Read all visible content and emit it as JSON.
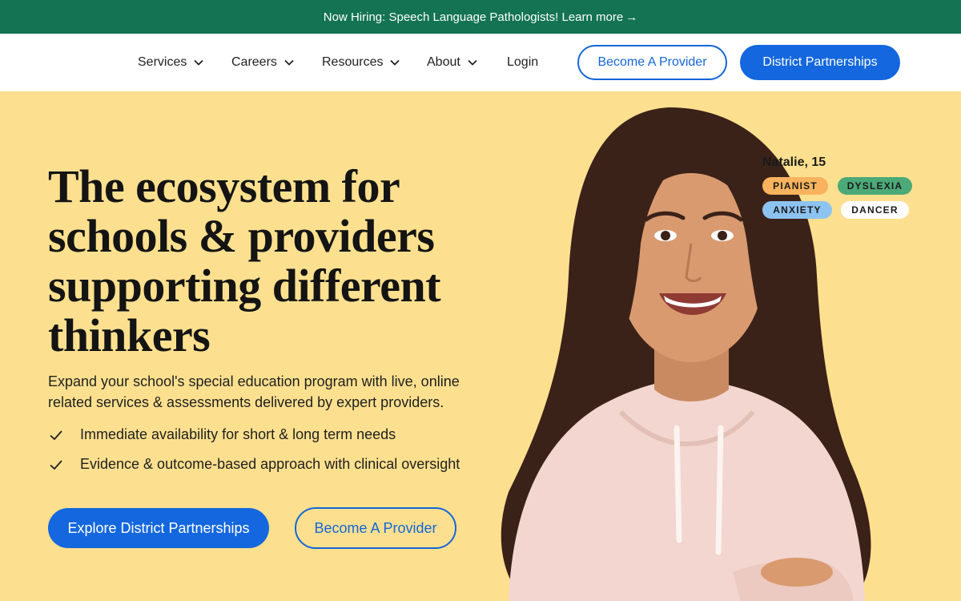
{
  "announcement": {
    "text": "Now Hiring: Speech Language Pathologists! Learn more",
    "arrow": "→"
  },
  "nav": {
    "items": [
      {
        "label": "Services"
      },
      {
        "label": "Careers"
      },
      {
        "label": "Resources"
      },
      {
        "label": "About"
      }
    ],
    "login": "Login",
    "become_provider": "Become A Provider",
    "district_partnerships": "District Partnerships"
  },
  "hero": {
    "headline": "The ecosystem for schools & providers supporting different thinkers",
    "subtext": "Expand your school's special education program with live, online related services & assessments delivered by expert providers.",
    "checks": [
      "Immediate availability for short & long term needs",
      "Evidence & outcome-based approach with clinical oversight"
    ],
    "cta_primary": "Explore District Partnerships",
    "cta_secondary": "Become A Provider"
  },
  "profile": {
    "name": "Natalie, 15",
    "tags": [
      "PIANIST",
      "DYSLEXIA",
      "ANXIETY",
      "DANCER"
    ]
  },
  "colors": {
    "banner": "#137352",
    "hero_bg": "#fde08f",
    "primary": "#1467de",
    "tag_pianist": "#f9b35e",
    "tag_dyslexia": "#4caa78",
    "tag_anxiety": "#8dc3f0",
    "tag_dancer": "#ffffff"
  }
}
